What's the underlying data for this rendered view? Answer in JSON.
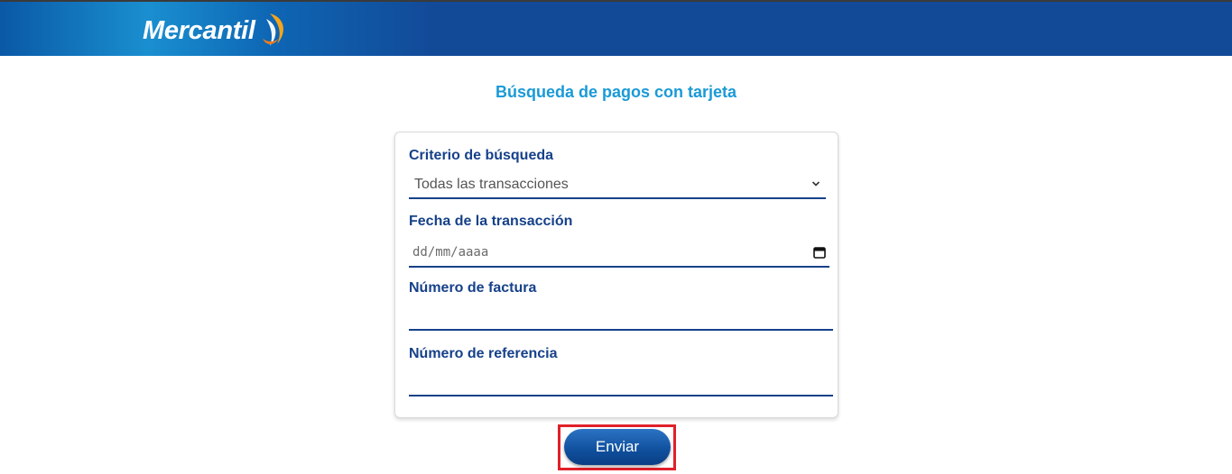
{
  "header": {
    "logo_text": "Mercantil",
    "background_color": "#124a98"
  },
  "page": {
    "title": "Búsqueda de pagos con tarjeta"
  },
  "form": {
    "criteria_label": "Criterio de búsqueda",
    "criteria_value": "Todas las transacciones",
    "date_label": "Fecha de la transacción",
    "date_placeholder": "dd/mm/aaaa",
    "invoice_label": "Número de factura",
    "invoice_value": "",
    "reference_label": "Número de referencia",
    "reference_value": ""
  },
  "actions": {
    "submit_label": "Enviar",
    "highlight_color": "#e0202a"
  },
  "colors": {
    "title": "#1a9ad6",
    "label": "#16418a",
    "button": "#0f4f9c"
  }
}
